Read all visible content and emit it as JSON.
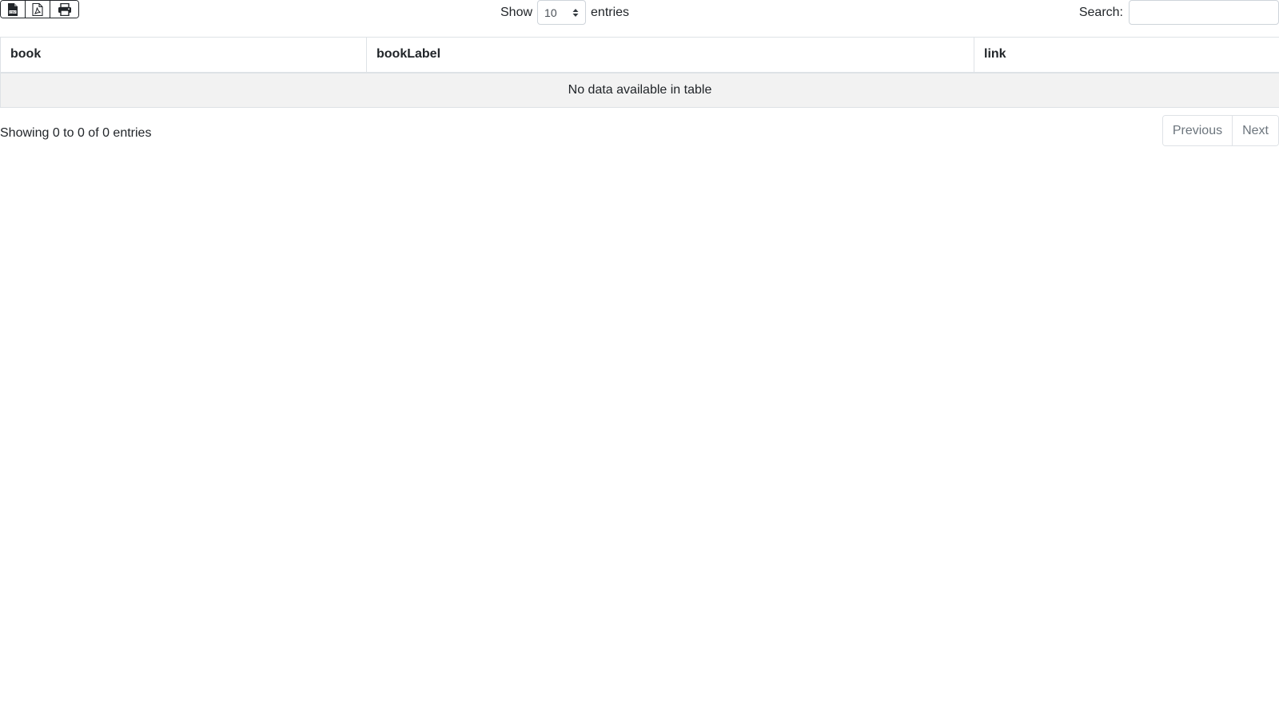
{
  "toolbar": {
    "export_buttons": [
      {
        "icon": "csv-file-icon"
      },
      {
        "icon": "pdf-file-icon"
      },
      {
        "icon": "print-icon"
      }
    ]
  },
  "length": {
    "prefix": "Show",
    "selected": "10",
    "suffix": "entries"
  },
  "search": {
    "label": "Search:",
    "value": "",
    "placeholder": ""
  },
  "table": {
    "columns": [
      "book",
      "bookLabel",
      "link"
    ],
    "empty_message": "No data available in table"
  },
  "footer": {
    "info": "Showing 0 to 0 of 0 entries",
    "previous_label": "Previous",
    "next_label": "Next"
  },
  "colors": {
    "text": "#212529",
    "muted": "#6c757d",
    "border": "#dee2e6",
    "empty_row_bg": "#f2f2f2"
  }
}
